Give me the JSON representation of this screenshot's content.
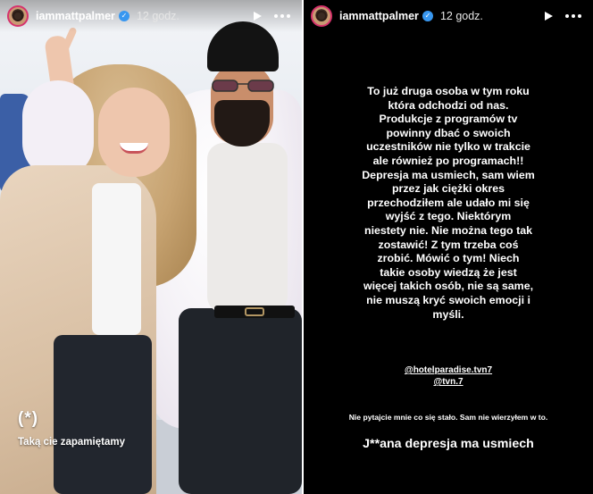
{
  "stories": [
    {
      "username": "iammattpalmer",
      "timestamp": "12 godz.",
      "sticker": "(*)",
      "caption": "Taką cie zapamiętamy"
    },
    {
      "username": "iammattpalmer",
      "timestamp": "12 godz.",
      "body_lines": [
        "To już druga osoba w tym roku",
        "która odchodzi od nas.",
        "Produkcje z programów tv",
        "powinny dbać o swoich",
        "uczestników nie tylko w trakcie",
        "ale również po programach!!",
        "Depresja ma usmiech, sam wiem",
        "przez jak ciężki okres",
        "przechodziłem ale udało mi się",
        "wyjść z tego. Niektórym",
        "niestety nie. Nie można tego tak",
        "zostawić! Z tym trzeba coś",
        "zrobić. Mówić o tym! Niech",
        "takie osoby wiedzą że jest",
        "więcej takich osób, nie są same,",
        "nie muszą kryć swoich emocji i",
        "myśli."
      ],
      "mentions": [
        "@hotelparadise.tvn7",
        "@tvn.7"
      ],
      "note": "Nie pytajcie mnie co się stało. Sam nie wierzyłem w to.",
      "footer": "J**ana depresja ma usmiech"
    }
  ],
  "icons": {
    "verified": "verified-badge-icon",
    "play": "play-icon",
    "more": "more-options-icon"
  },
  "colors": {
    "right_background": "#000000",
    "verified_blue": "#3897f0",
    "avatar_ring": "#d6336c",
    "text": "#ffffff"
  }
}
